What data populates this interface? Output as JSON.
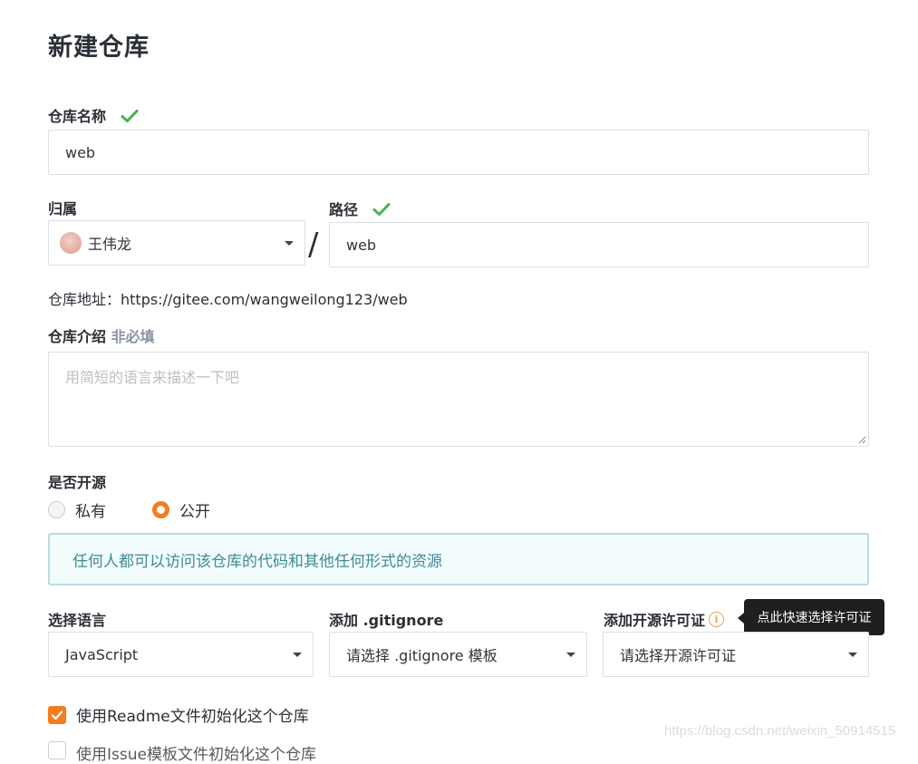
{
  "page": {
    "title": "新建仓库"
  },
  "repo_name": {
    "label": "仓库名称",
    "value": "web",
    "valid": true
  },
  "owner": {
    "label": "归属",
    "value": "王伟龙"
  },
  "path": {
    "label": "路径",
    "value": "web",
    "valid": true,
    "separator": "/"
  },
  "repo_url": {
    "text": "仓库地址：https://gitee.com/wangweilong123/web"
  },
  "description": {
    "label": "仓库介绍",
    "optional_tag": "非必填",
    "placeholder": "用简短的语言来描述一下吧"
  },
  "visibility": {
    "label": "是否开源",
    "options": [
      {
        "label": "私有",
        "selected": false
      },
      {
        "label": "公开",
        "selected": true
      }
    ],
    "info": "任何人都可以访问该仓库的代码和其他任何形式的资源"
  },
  "language": {
    "label": "选择语言",
    "value": "JavaScript"
  },
  "gitignore": {
    "label": "添加 .gitignore",
    "value": "请选择 .gitignore 模板"
  },
  "license": {
    "label": "添加开源许可证",
    "value": "请选择开源许可证",
    "tooltip": "点此快速选择许可证"
  },
  "init_readme": {
    "label": "使用Readme文件初始化这个仓库",
    "checked": true
  },
  "next_option": {
    "label": "使用Issue模板文件初始化这个仓库"
  },
  "watermark": "https://blog.csdn.net/weixin_50914515",
  "colors": {
    "accent": "#f57c1f",
    "success": "#4caf50",
    "info_text": "#3f8a96",
    "info_border": "#b6dde2"
  }
}
